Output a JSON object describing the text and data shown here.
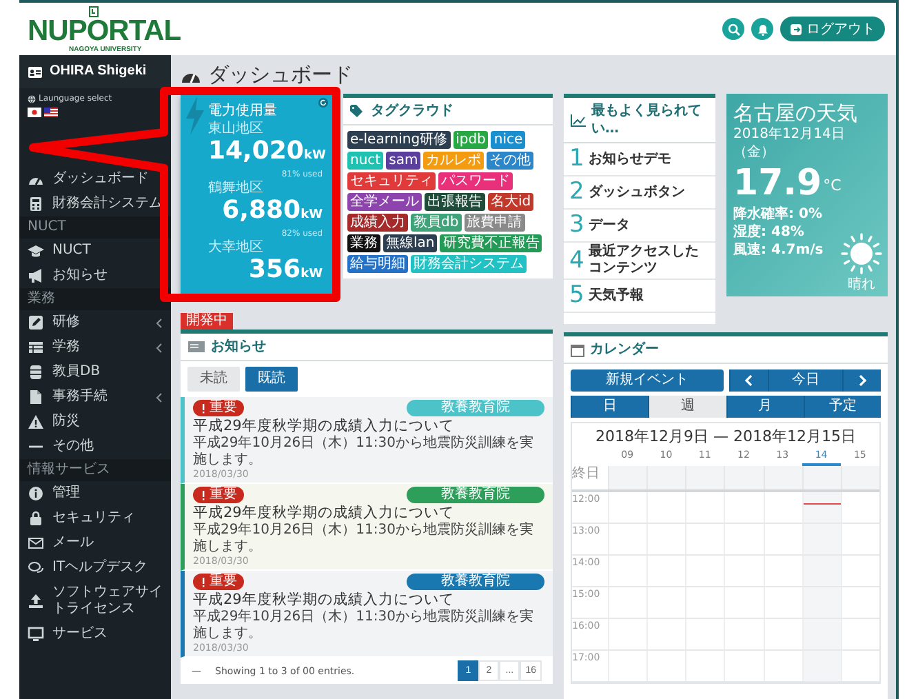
{
  "header": {
    "logo": "NUPORTAL",
    "logo_sub": "NAGOYA UNIVERSITY",
    "logout": "ログアウト"
  },
  "sidebar": {
    "user": "OHIRA Shigeki",
    "language_label": "Launguage select",
    "items": [
      {
        "kind": "item",
        "label": "ダッシュボード",
        "submenu": false
      },
      {
        "kind": "item",
        "label": "財務会計システム",
        "submenu": false
      },
      {
        "kind": "section",
        "label": "NUCT"
      },
      {
        "kind": "item",
        "label": "NUCT",
        "submenu": false
      },
      {
        "kind": "item",
        "label": "お知らせ",
        "submenu": false
      },
      {
        "kind": "section",
        "label": "業務"
      },
      {
        "kind": "item",
        "label": "研修",
        "submenu": true
      },
      {
        "kind": "item",
        "label": "学務",
        "submenu": true
      },
      {
        "kind": "item",
        "label": "教員DB",
        "submenu": false
      },
      {
        "kind": "item",
        "label": "事務手続",
        "submenu": true
      },
      {
        "kind": "item",
        "label": "防災",
        "submenu": false
      },
      {
        "kind": "item",
        "label": "その他",
        "submenu": false
      },
      {
        "kind": "section",
        "label": "情報サービス"
      },
      {
        "kind": "item",
        "label": "管理",
        "submenu": false
      },
      {
        "kind": "item",
        "label": "セキュリティ",
        "submenu": false
      },
      {
        "kind": "item",
        "label": "メール",
        "submenu": false
      },
      {
        "kind": "item",
        "label": "ITヘルプデスク",
        "submenu": false
      },
      {
        "kind": "item",
        "label": "ソフトウェアサイトライセンス",
        "submenu": false
      },
      {
        "kind": "item",
        "label": "サービス",
        "submenu": false
      }
    ]
  },
  "page_title": "ダッシュボード",
  "power": {
    "title": "電力使用量",
    "sites": [
      {
        "name": "東山地区",
        "value": "14,020",
        "unit": "kW",
        "usage": "81% used"
      },
      {
        "name": "鶴舞地区",
        "value": "6,880",
        "unit": "kW",
        "usage": "82% used"
      },
      {
        "name": "大幸地区",
        "value": "356",
        "unit": "kW"
      }
    ]
  },
  "tag_cloud": {
    "title": "タグクラウド",
    "tags": [
      {
        "label": "e-learning研修",
        "color": "#2c3e50"
      },
      {
        "label": "ipdb",
        "color": "#27a844"
      },
      {
        "label": "nice",
        "color": "#1a8fd0"
      },
      {
        "label": "nuct",
        "color": "#1fc1b0"
      },
      {
        "label": "sam",
        "color": "#5b3f9e"
      },
      {
        "label": "カルレポ",
        "color": "#f39c12"
      },
      {
        "label": "その他",
        "color": "#2c86c8"
      },
      {
        "label": "セキュリティ",
        "color": "#e03a3a"
      },
      {
        "label": "パスワード",
        "color": "#e8317a"
      },
      {
        "label": "全学メール",
        "color": "#8e44ad"
      },
      {
        "label": "出張報告",
        "color": "#1f4d3a"
      },
      {
        "label": "名大id",
        "color": "#c0392b"
      },
      {
        "label": "成績入力",
        "color": "#a52a2a"
      },
      {
        "label": "教員db",
        "color": "#3fa37a"
      },
      {
        "label": "旅費申請",
        "color": "#8a8a8a"
      },
      {
        "label": "業務",
        "color": "#111111"
      },
      {
        "label": "無線lan",
        "color": "#2c3e50"
      },
      {
        "label": "研究費不正報告",
        "color": "#239b56"
      },
      {
        "label": "給与明細",
        "color": "#2471c8"
      },
      {
        "label": "財務会計システム",
        "color": "#22c1c3"
      }
    ]
  },
  "most_viewed": {
    "title": "最もよく見られてい…",
    "items": [
      {
        "rank": "1",
        "label": "お知らせデモ"
      },
      {
        "rank": "2",
        "label": "ダッシュボタン"
      },
      {
        "rank": "3",
        "label": "データ"
      },
      {
        "rank": "4",
        "label": "最近アクセスしたコンテンツ"
      },
      {
        "rank": "5",
        "label": "天気予報"
      }
    ]
  },
  "weather": {
    "title": "名古屋の天気",
    "date": "2018年12月14日（金）",
    "temperature": "17.9",
    "unit": "°C",
    "details": [
      "降水確率: 0%",
      "湿度: 48%",
      "風速: 4.7m/s"
    ],
    "condition": "晴れ"
  },
  "notices": {
    "status_badge": "開発中",
    "title": "お知らせ",
    "tabs": [
      {
        "label": "未読",
        "selected": false
      },
      {
        "label": "既読",
        "selected": true
      }
    ],
    "items": [
      {
        "badge": "重要",
        "category": "教養教育院",
        "color": "#4cc3c9",
        "title": "平成29年度秋学期の成績入力について",
        "body": "平成29年10月26日（木）11:30から地震防災訓練を実施します。",
        "date": "2018/03/30"
      },
      {
        "badge": "重要",
        "category": "教養教育院",
        "color": "#2e9e5b",
        "title": "平成29年度秋学期の成績入力について",
        "body": "平成29年10月26日（木）11:30から地震防災訓練を実施します。",
        "date": "2018/03/30"
      },
      {
        "badge": "重要",
        "category": "教養教育院",
        "color": "#1a78b0",
        "title": "平成29年度秋学期の成績入力について",
        "body": "平成29年10月26日（木）11:30から地震防災訓練を実施します。",
        "date": "2018/03/30"
      }
    ],
    "length_menu": "—",
    "summary": "Showing 1 to 3 of 00 entries.",
    "pages": [
      {
        "label": "1",
        "selected": true
      },
      {
        "label": "2",
        "selected": false
      },
      {
        "label": "...",
        "selected": false
      },
      {
        "label": "16",
        "selected": false
      }
    ]
  },
  "calendar": {
    "title": "カレンダー",
    "new_event": "新規イベント",
    "today": "今日",
    "views": [
      {
        "label": "日",
        "selected": false
      },
      {
        "label": "週",
        "selected": true
      },
      {
        "label": "月",
        "selected": false
      },
      {
        "label": "予定",
        "selected": false
      }
    ],
    "range": "2018年12月9日 — 2018年12月15日",
    "days": [
      {
        "label": "09",
        "selected": false
      },
      {
        "label": "10",
        "selected": false
      },
      {
        "label": "11",
        "selected": false
      },
      {
        "label": "12",
        "selected": false
      },
      {
        "label": "13",
        "selected": false
      },
      {
        "label": "14",
        "selected": true
      },
      {
        "label": "15",
        "selected": false
      }
    ],
    "all_day": "終日",
    "times": [
      "12:00",
      "13:00",
      "14:00",
      "15:00",
      "16:00",
      "17:00"
    ]
  },
  "annotation": {
    "kind": "callout"
  }
}
